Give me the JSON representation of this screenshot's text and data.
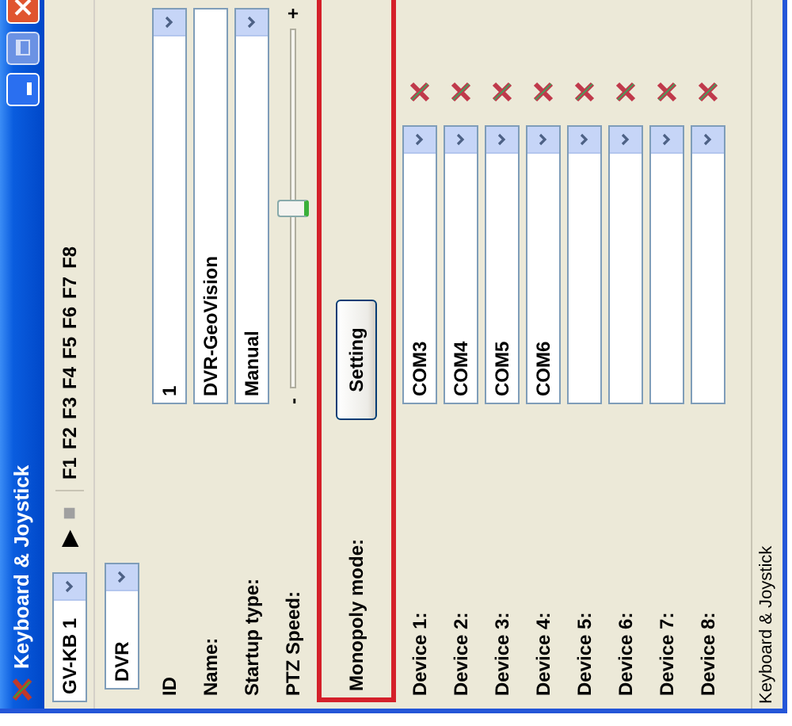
{
  "window": {
    "title": "Keyboard & Joystick"
  },
  "toolbar": {
    "keyboard": "GV-KB 1",
    "play": "▶",
    "stop": "■",
    "function_keys": [
      "F1",
      "F2",
      "F3",
      "F4",
      "F5",
      "F6",
      "F7",
      "F8"
    ]
  },
  "device_type": "DVR",
  "fields": [
    {
      "kind": "combo",
      "label": "ID",
      "value": "1"
    },
    {
      "kind": "text",
      "label": "Name:",
      "value": "DVR-GeoVision"
    },
    {
      "kind": "combo",
      "label": "Startup type:",
      "value": "Manual"
    },
    {
      "kind": "slider",
      "label": "PTZ Speed:",
      "min": "-",
      "max": "+",
      "level": 0.5
    },
    {
      "kind": "button",
      "label": "Monopoly mode:",
      "value": "Setting",
      "highlighted": true
    }
  ],
  "devices": [
    {
      "label": "Device 1:",
      "port": "COM3"
    },
    {
      "label": "Device 2:",
      "port": "COM4"
    },
    {
      "label": "Device 3:",
      "port": "COM5"
    },
    {
      "label": "Device 4:",
      "port": "COM6"
    },
    {
      "label": "Device 5:"
    },
    {
      "label": "Device 6:"
    },
    {
      "label": "Device 7:"
    },
    {
      "label": "Device 8:"
    }
  ],
  "status_bar": "Keyboard & Joystick"
}
